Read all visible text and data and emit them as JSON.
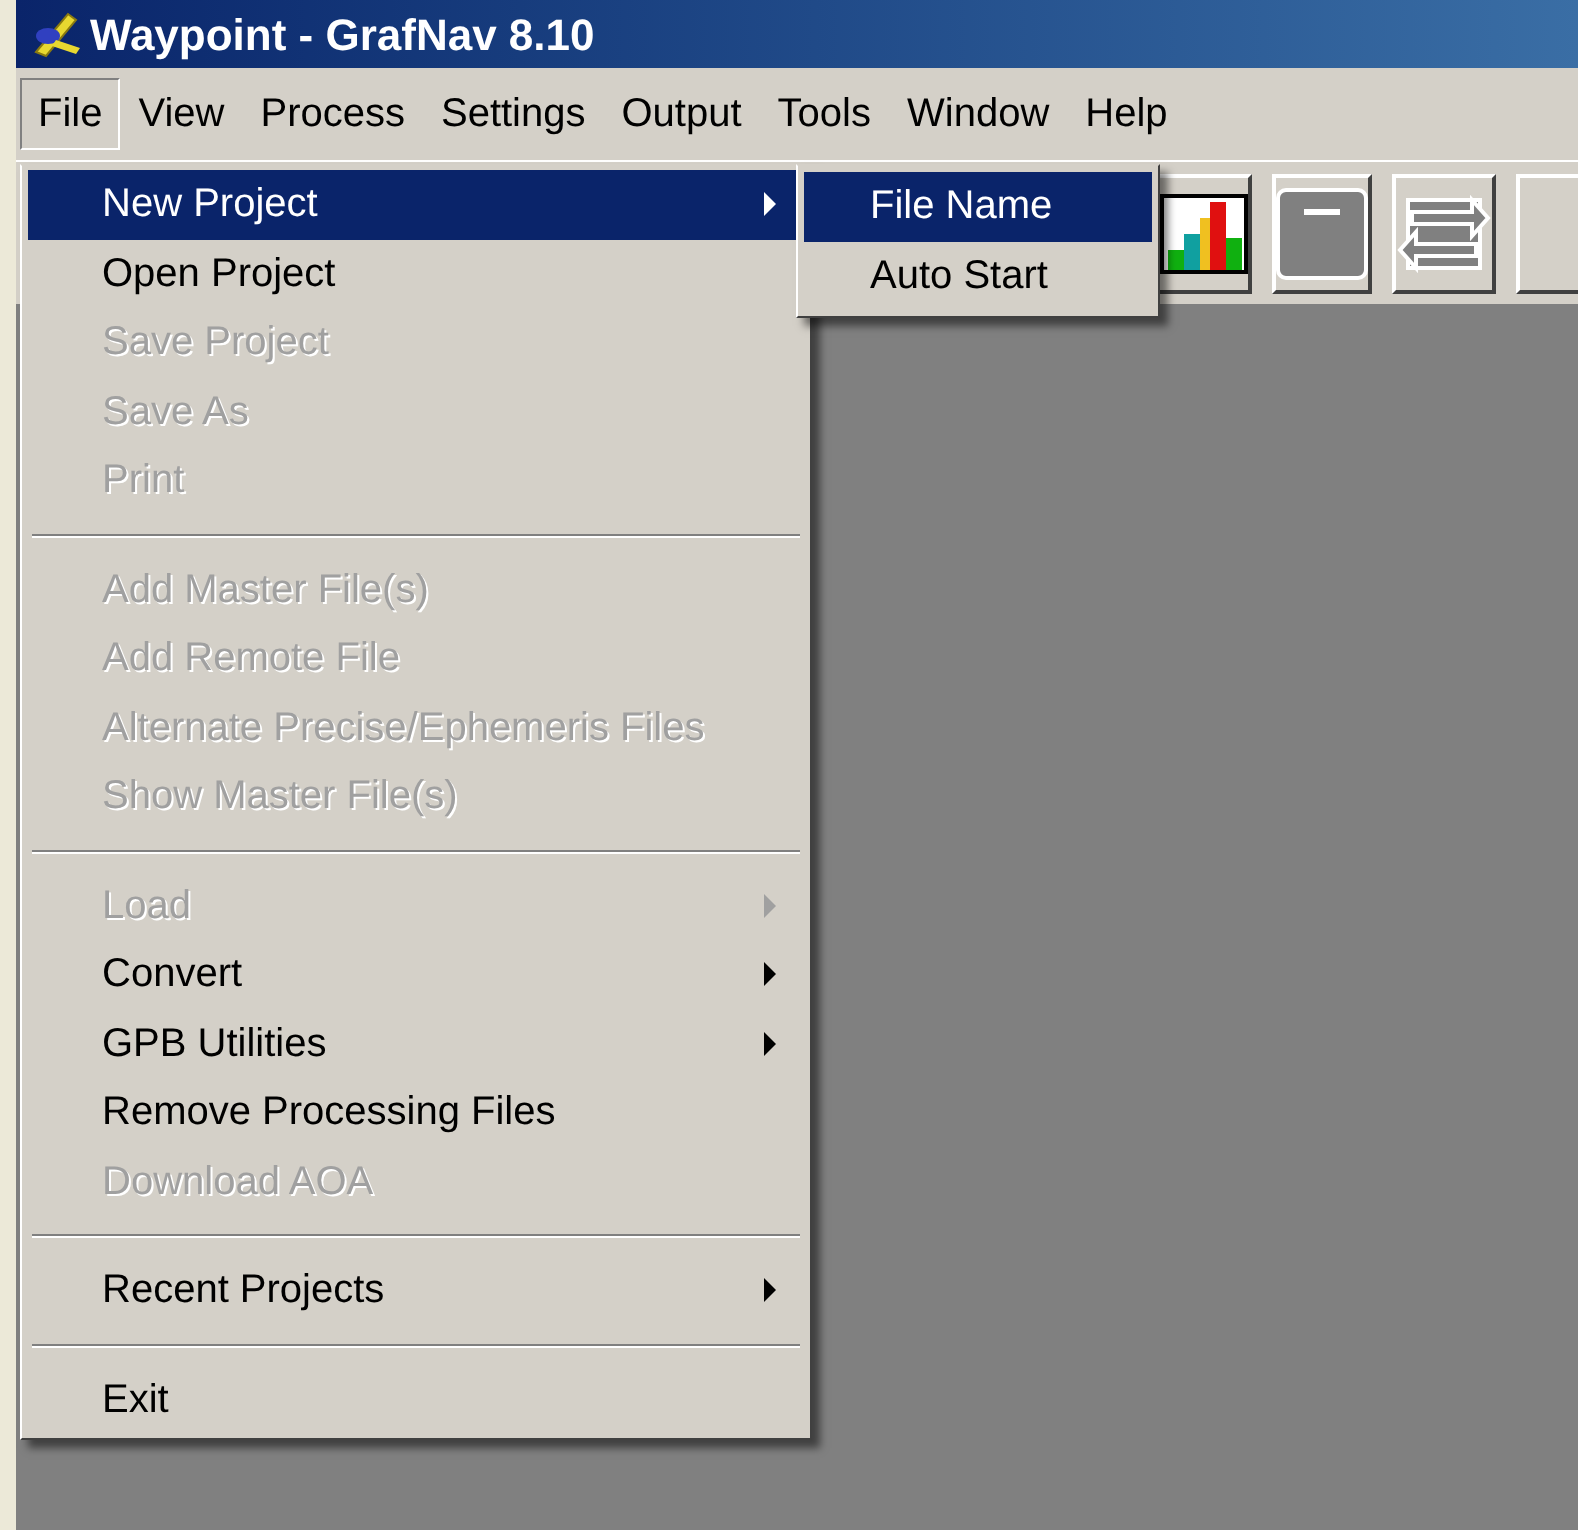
{
  "window": {
    "title": "Waypoint - GrafNav 8.10"
  },
  "menu_bar": [
    {
      "label": "File",
      "selected": true
    },
    {
      "label": "View",
      "selected": false
    },
    {
      "label": "Process",
      "selected": false
    },
    {
      "label": "Settings",
      "selected": false
    },
    {
      "label": "Output",
      "selected": false
    },
    {
      "label": "Tools",
      "selected": false
    },
    {
      "label": "Window",
      "selected": false
    },
    {
      "label": "Help",
      "selected": false
    }
  ],
  "file_menu": [
    {
      "kind": "item",
      "label": "New Project",
      "disabled": false,
      "submenu": true,
      "selected": true
    },
    {
      "kind": "item",
      "label": "Open Project",
      "disabled": false,
      "submenu": false,
      "selected": false
    },
    {
      "kind": "item",
      "label": "Save Project",
      "disabled": true,
      "submenu": false,
      "selected": false
    },
    {
      "kind": "item",
      "label": "Save As",
      "disabled": true,
      "submenu": false,
      "selected": false
    },
    {
      "kind": "item",
      "label": "Print",
      "disabled": true,
      "submenu": false,
      "selected": false
    },
    {
      "kind": "separator"
    },
    {
      "kind": "item",
      "label": "Add Master File(s)",
      "disabled": true,
      "submenu": false,
      "selected": false
    },
    {
      "kind": "item",
      "label": "Add Remote File",
      "disabled": true,
      "submenu": false,
      "selected": false
    },
    {
      "kind": "item",
      "label": "Alternate Precise/Ephemeris Files",
      "disabled": true,
      "submenu": false,
      "selected": false
    },
    {
      "kind": "item",
      "label": "Show Master File(s)",
      "disabled": true,
      "submenu": false,
      "selected": false
    },
    {
      "kind": "separator"
    },
    {
      "kind": "item",
      "label": "Load",
      "disabled": true,
      "submenu": true,
      "selected": false
    },
    {
      "kind": "item",
      "label": "Convert",
      "disabled": false,
      "submenu": true,
      "selected": false
    },
    {
      "kind": "item",
      "label": "GPB Utilities",
      "disabled": false,
      "submenu": true,
      "selected": false
    },
    {
      "kind": "item",
      "label": "Remove Processing Files",
      "disabled": false,
      "submenu": false,
      "selected": false
    },
    {
      "kind": "item",
      "label": "Download AOA",
      "disabled": true,
      "submenu": false,
      "selected": false
    },
    {
      "kind": "separator"
    },
    {
      "kind": "item",
      "label": "Recent Projects",
      "disabled": false,
      "submenu": true,
      "selected": false
    },
    {
      "kind": "separator"
    },
    {
      "kind": "item",
      "label": "Exit",
      "disabled": false,
      "submenu": false,
      "selected": false
    }
  ],
  "new_project_submenu": [
    {
      "label": "File Name",
      "selected": true
    },
    {
      "label": "Auto Start",
      "selected": false
    }
  ]
}
